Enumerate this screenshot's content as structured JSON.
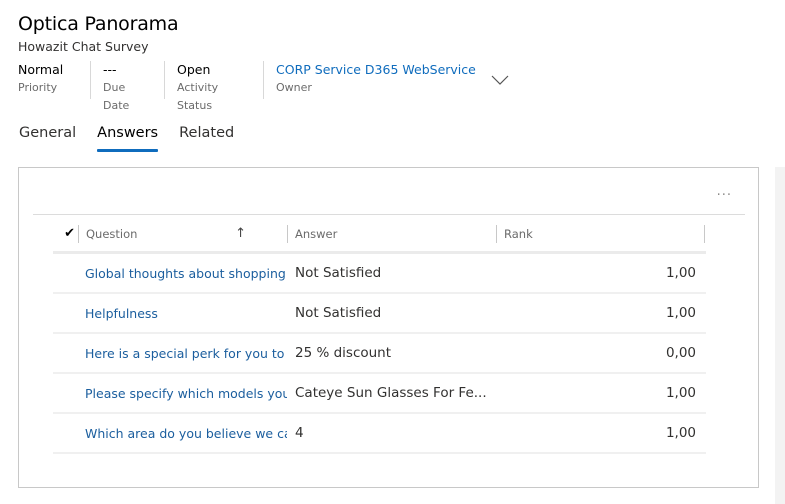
{
  "header": {
    "title": "Optica Panorama",
    "subtitle": "Howazit Chat Survey",
    "fields": [
      {
        "value": "Normal",
        "label": "Priority"
      },
      {
        "value": "---",
        "label": "Due Date"
      },
      {
        "value": "Open",
        "label": "Activity Status"
      },
      {
        "value": "CORP Service D365 WebService",
        "label": "Owner"
      }
    ],
    "expand_icon": "chevron-down-icon"
  },
  "tabs": [
    {
      "label": "General",
      "active": false
    },
    {
      "label": "Answers",
      "active": true
    },
    {
      "label": "Related",
      "active": false
    }
  ],
  "grid": {
    "more_label": "...",
    "columns": [
      {
        "label": "Question",
        "sort": "ascending"
      },
      {
        "label": "Answer"
      },
      {
        "label": "Rank"
      }
    ],
    "select_all_icon": "checkmark-icon",
    "sort_icon": "arrow-up-icon",
    "rows": [
      {
        "question": "Global thoughts about shopping",
        "answer": "Not Satisfied",
        "rank": "1,00"
      },
      {
        "question": "Helpfulness",
        "answer": "Not Satisfied",
        "rank": "1,00"
      },
      {
        "question": "Here is a special perk for you to s",
        "answer": "25 % discount",
        "rank": "0,00"
      },
      {
        "question": "Please specify which models you",
        "answer": "Cateye Sun Glasses For Fe...",
        "rank": "1,00"
      },
      {
        "question": "Which area do you believe we ca",
        "answer": "4",
        "rank": "1,00"
      }
    ]
  },
  "colors": {
    "accent": "#0f6cbd",
    "link": "#1b5e9e"
  }
}
